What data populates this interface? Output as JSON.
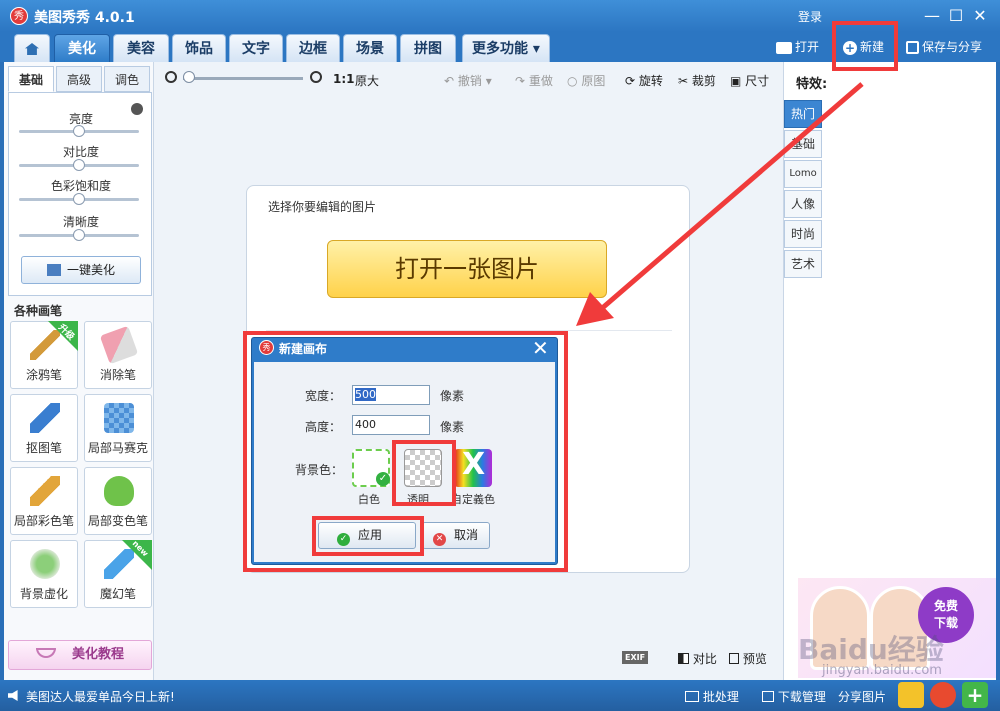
{
  "app": {
    "logo_glyph": "秀",
    "title": "美图秀秀 4.0.1",
    "login": "登录"
  },
  "window_controls": {
    "minimize": "—",
    "maximize": "☐",
    "close": "✕"
  },
  "nav_tabs": [
    {
      "label": "美化",
      "active": true
    },
    {
      "label": "美容"
    },
    {
      "label": "饰品"
    },
    {
      "label": "文字"
    },
    {
      "label": "边框"
    },
    {
      "label": "场景"
    },
    {
      "label": "拼图"
    },
    {
      "label": "更多功能 ▾"
    }
  ],
  "top_actions": {
    "open": "打开",
    "new": "新建",
    "save_share": "保存与分享"
  },
  "left_subtabs": [
    "基础",
    "高级",
    "调色"
  ],
  "adjustments": [
    {
      "label": "亮度",
      "value": 0.5
    },
    {
      "label": "对比度",
      "value": 0.5
    },
    {
      "label": "色彩饱和度",
      "value": 0.5
    },
    {
      "label": "清晰度",
      "value": 0.5
    }
  ],
  "one_key_beautify": "一键美化",
  "brush_section_title": "各种画笔",
  "brushes": [
    {
      "label": "涂鸦笔",
      "badge": "升级"
    },
    {
      "label": "消除笔"
    },
    {
      "label": "抠图笔"
    },
    {
      "label": "局部马赛克"
    },
    {
      "label": "局部彩色笔"
    },
    {
      "label": "局部变色笔"
    },
    {
      "label": "背景虚化"
    },
    {
      "label": "魔幻笔",
      "badge": "new"
    }
  ],
  "tutorial": "美化教程",
  "toolbar": {
    "zoom_ratio": "1:1",
    "original_size": "原大",
    "undo": "撤销",
    "redo": "重做",
    "original": "原图",
    "rotate": "旋转",
    "crop": "裁剪",
    "resize": "尺寸"
  },
  "canvas": {
    "hint": "选择你要编辑的图片",
    "open_button": "打开一张图片"
  },
  "effects": {
    "title": "特效:",
    "tabs": [
      "热门",
      "基础",
      "Lomo",
      "人像",
      "时尚",
      "艺术"
    ]
  },
  "ad": {
    "download": "免费\n下载"
  },
  "watermark": {
    "text": "Baidu经验",
    "url": "jingyan.baidu.com"
  },
  "compare": {
    "exif": "EXIF",
    "compare": "对比",
    "preview": "预览"
  },
  "dialog": {
    "title": "新建画布",
    "width_label": "宽度：",
    "width_value": "500",
    "height_label": "高度：",
    "height_value": "400",
    "unit": "像素",
    "bg_label": "背景色：",
    "bg_options": [
      "白色",
      "透明",
      "自定義色"
    ],
    "apply": "应用",
    "cancel": "取消"
  },
  "statusbar": {
    "message": "美图达人最爱单品今日上新!",
    "batch": "批处理",
    "download_mgr": "下载管理",
    "share": "分享图片"
  },
  "colors": {
    "accent_blue": "#2c76c2",
    "annotation_red": "#f03b3b",
    "open_button_yellow": "#ffd24a"
  }
}
